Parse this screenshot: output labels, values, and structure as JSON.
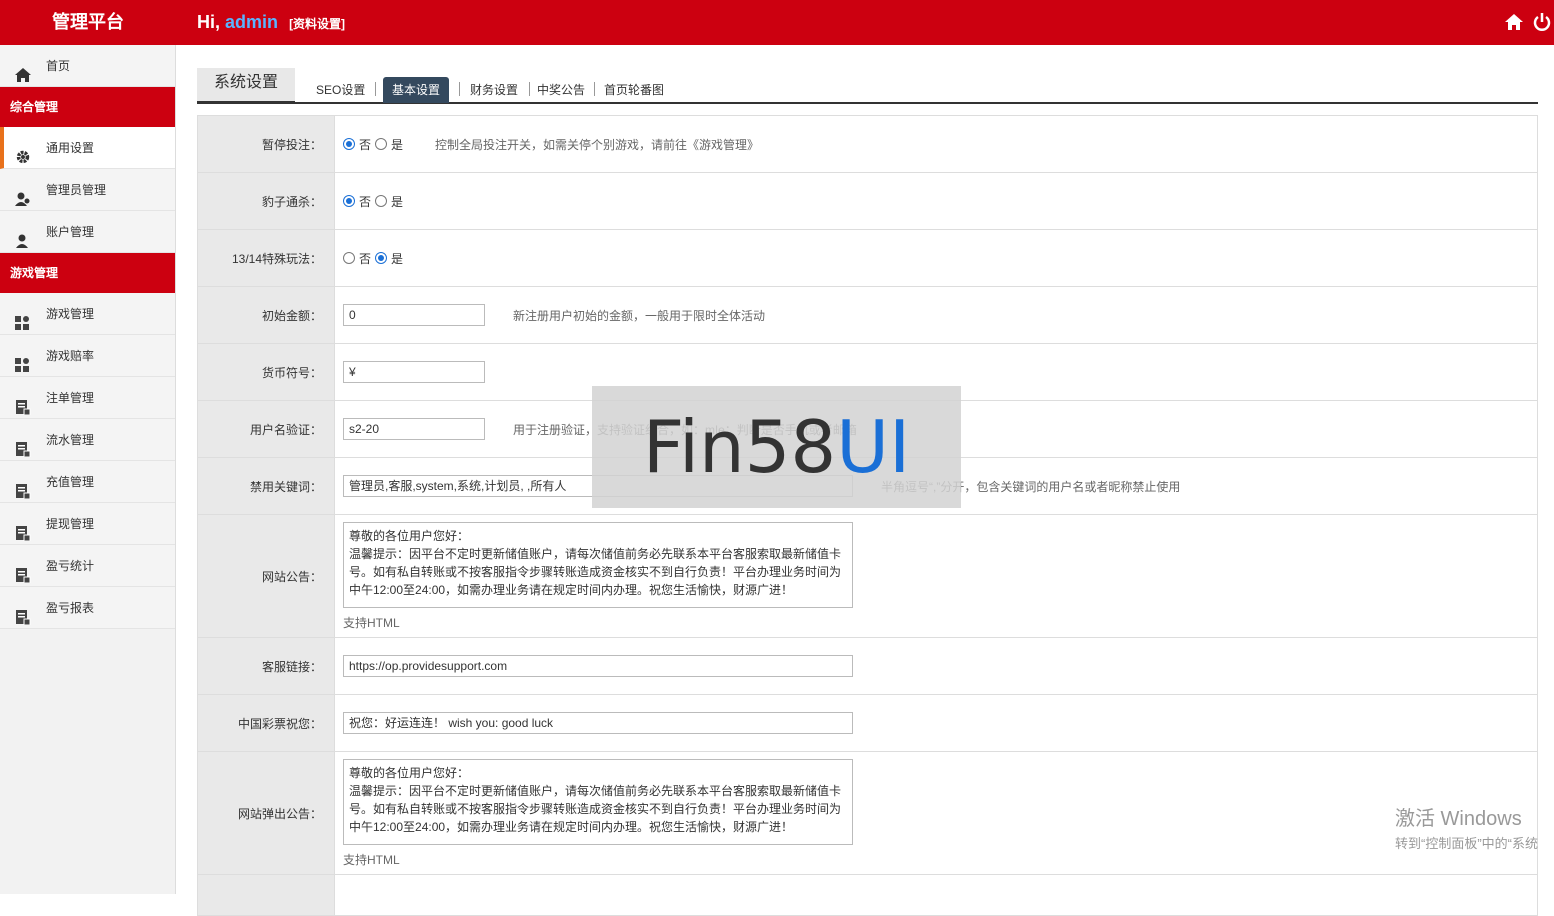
{
  "header": {
    "brand": "管理平台",
    "greeting": "Hi,",
    "username": "admin",
    "profile_link": "[资料设置]",
    "home_icon": "home-icon",
    "power_icon": "power-icon",
    "bg_color": "#cc0010"
  },
  "sidebar": {
    "home": {
      "label": "首页",
      "icon": "home-icon"
    },
    "sections": [
      {
        "title": "综合管理",
        "items": [
          {
            "label": "通用设置",
            "icon": "gear-icon",
            "active": true
          },
          {
            "label": "管理员管理",
            "icon": "users-icon"
          },
          {
            "label": "账户管理",
            "icon": "user-icon"
          }
        ]
      },
      {
        "title": "游戏管理",
        "items": [
          {
            "label": "游戏管理",
            "icon": "grid-icon"
          },
          {
            "label": "游戏赔率",
            "icon": "grid-icon"
          },
          {
            "label": "注单管理",
            "icon": "doc-icon"
          },
          {
            "label": "流水管理",
            "icon": "doc-icon"
          },
          {
            "label": "充值管理",
            "icon": "doc-icon"
          },
          {
            "label": "提现管理",
            "icon": "doc-icon"
          },
          {
            "label": "盈亏统计",
            "icon": "doc-icon"
          },
          {
            "label": "盈亏报表",
            "icon": "doc-icon"
          }
        ]
      }
    ]
  },
  "tabs": {
    "main": "系统设置",
    "sub": [
      "SEO设置",
      "基本设置",
      "财务设置",
      "中奖公告",
      "首页轮番图"
    ],
    "active": "基本设置"
  },
  "form": {
    "pause_bet": {
      "label": "暂停投注：",
      "options": [
        "否",
        "是"
      ],
      "selected": "否",
      "hint": "控制全局投注开关，如需关停个别游戏，请前往《游戏管理》"
    },
    "leopard_kill": {
      "label": "豹子通杀：",
      "options": [
        "否",
        "是"
      ],
      "selected": "否"
    },
    "special_play": {
      "label": "13/14特殊玩法：",
      "options": [
        "否",
        "是"
      ],
      "selected": "是"
    },
    "initial_amount": {
      "label": "初始金额：",
      "value": "0",
      "hint": "新注册用户初始的金额，一般用于限时全体活动"
    },
    "currency": {
      "label": "货币符号：",
      "value": "¥"
    },
    "username_validation": {
      "label": "用户名验证：",
      "value": "s2-20",
      "hint": "用于注册验证，支持验证组合，如：m|e：判断是否手机或者邮箱"
    },
    "banned_keywords": {
      "label": "禁用关键词：",
      "value": "管理员,客服,system,系统,计划员, ,所有人",
      "hint": "半角逗号“,”分开，包含关键词的用户名或者昵称禁止使用"
    },
    "site_notice": {
      "label": "网站公告：",
      "value": "尊敬的各位用户您好：\n温馨提示：因平台不定时更新储值账户，请每次储值前务必先联系本平台客服索取最新储值卡号。如有私自转账或不按客服指令步骤转账造成资金核实不到自行负责！平台办理业务时间为中午12:00至24:00，如需办理业务请在规定时间内办理。祝您生活愉快，财源广进！",
      "note": "支持HTML"
    },
    "support_link": {
      "label": "客服链接：",
      "value": "https://op.providesupport.com"
    },
    "lottery_wish": {
      "label": "中国彩票祝您：",
      "value": "祝您：好运连连！ wish you: good luck"
    },
    "popup_notice": {
      "label": "网站弹出公告：",
      "value": "尊敬的各位用户您好：\n温馨提示：因平台不定时更新储值账户，请每次储值前务必先联系本平台客服索取最新储值卡号。如有私自转账或不按客服指令步骤转账造成资金核实不到自行负责！平台办理业务时间为中午12:00至24:00，如需办理业务请在规定时间内办理。祝您生活愉快，财源广进！",
      "note": "支持HTML"
    }
  },
  "watermark": {
    "part1": "Fin58",
    "part2": "UI"
  },
  "os_overlay": {
    "line1": "激活 Windows",
    "line2": "转到“控制面板”中的“系统"
  }
}
